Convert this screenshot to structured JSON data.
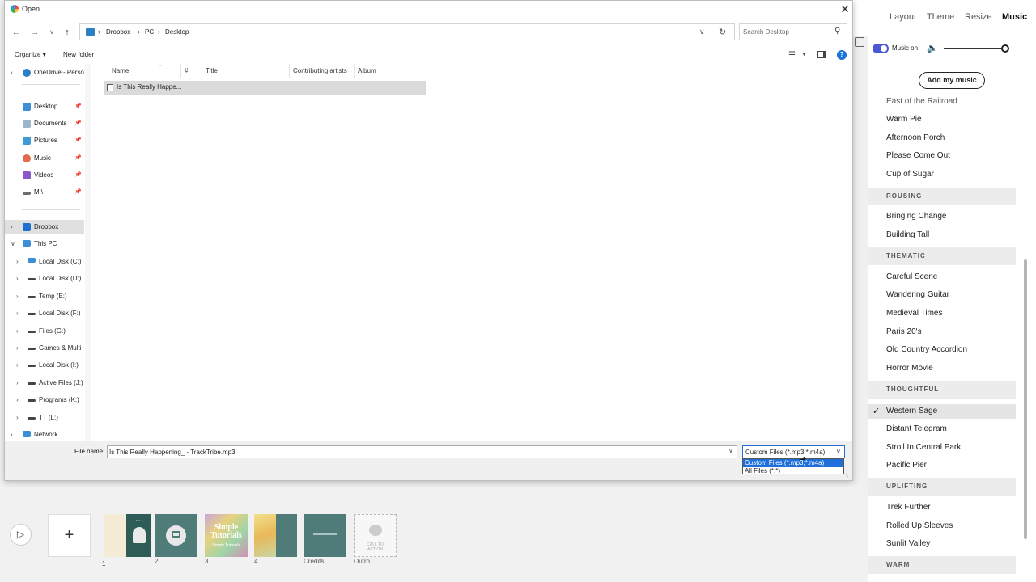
{
  "app": {
    "tabs": [
      {
        "label": "Layout"
      },
      {
        "label": "Theme"
      },
      {
        "label": "Resize"
      },
      {
        "label": "Music"
      }
    ],
    "music_on_label": "Music on",
    "volume_level": 0.95,
    "add_music_label": "Add my music",
    "accent": "#4a58d6"
  },
  "music": {
    "partial_top": "East of the Railroad",
    "tracks_a": [
      "Warm Pie",
      "Afternoon Porch",
      "Please Come Out",
      "Cup of Sugar"
    ],
    "cat_rousing": "ROUSING",
    "tracks_rousing": [
      "Bringing Change",
      "Building Tall"
    ],
    "cat_thematic": "THEMATIC",
    "tracks_thematic": [
      "Careful Scene",
      "Wandering Guitar",
      "Medieval Times",
      "Paris 20's",
      "Old Country Accordion",
      "Horror Movie"
    ],
    "cat_thoughtful": "THOUGHTFUL",
    "tracks_thoughtful": [
      "Western Sage",
      "Distant Telegram",
      "Stroll In Central Park",
      "Pacific Pier"
    ],
    "cat_uplifting": "UPLIFTING",
    "tracks_uplifting": [
      "Trek Further",
      "Rolled Up Sleeves",
      "Sunlit Valley"
    ],
    "cat_warm": "WARM",
    "selected": "Western Sage"
  },
  "timeline": {
    "add_symbol": "+",
    "slides": [
      "1",
      "2",
      "3",
      "4",
      "Credits",
      "Outro"
    ],
    "slide3_title": "Simple Tutorials",
    "slide3_sub": "Simply Tutorials",
    "cta_text": "CALL TO ACTION"
  },
  "dialog": {
    "title": "Open",
    "breadcrumb": [
      "Dropbox",
      "PC",
      "Desktop"
    ],
    "search_placeholder": "Search Desktop",
    "toolbar": {
      "organize": "Organize",
      "new_folder": "New folder"
    },
    "nav": {
      "onedrive": "OneDrive - Perso",
      "desktop": "Desktop",
      "documents": "Documents",
      "pictures": "Pictures",
      "music": "Music",
      "videos": "Videos",
      "m_drive": "M:\\",
      "dropbox": "Dropbox",
      "this_pc": "This PC",
      "drives": [
        "Local Disk (C:)",
        "Local Disk (D:)",
        "Temp (E:)",
        "Local Disk (F:)",
        "Files (G:)",
        "Games & Multi",
        "Local Disk (I:)",
        "Active Files (J:)",
        "Programs (K:)",
        "TT (L:)"
      ],
      "network": "Network"
    },
    "columns": [
      "Name",
      "#",
      "Title",
      "Contributing artists",
      "Album"
    ],
    "file": "Is This Really Happe...",
    "filename_label": "File name:",
    "filename_value": "Is This Really Happening_ - TrackTribe.mp3",
    "filetype_value": "Custom Files (*.mp3;*.m4a)",
    "filetype_options": [
      "Custom Files (*.mp3;*.m4a)",
      "All Files (*.*)"
    ]
  }
}
